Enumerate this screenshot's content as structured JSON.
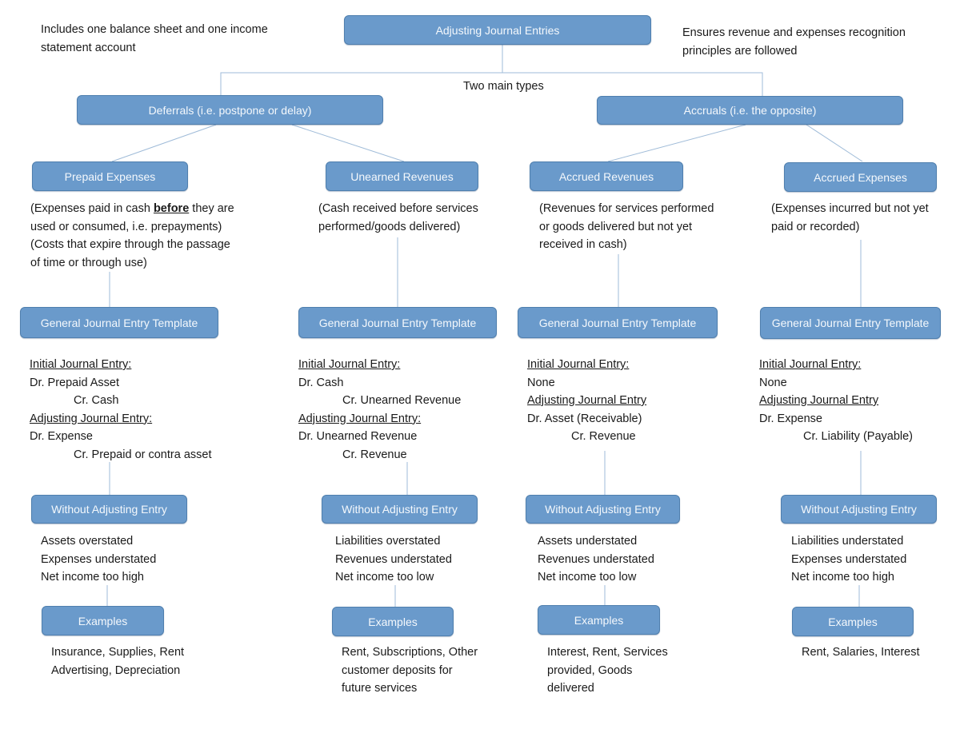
{
  "root": {
    "title": "Adjusting Journal Entries",
    "note_left": [
      "Includes one balance sheet and one income",
      "statement account"
    ],
    "note_right": [
      "Ensures revenue and expenses recognition",
      "principles are followed"
    ],
    "branch_label": "Two main types"
  },
  "types": [
    {
      "label": "Deferrals (i.e. postpone or delay)"
    },
    {
      "label": "Accruals (i.e. the opposite)"
    }
  ],
  "columns": [
    {
      "title": "Prepaid Expenses",
      "description": [
        {
          "pre": "(Expenses paid in cash ",
          "em": "before",
          "post": " they are"
        },
        {
          "pre": "used or consumed, i.e. prepayments)"
        },
        {
          "pre": "(Costs that expire through the passage"
        },
        {
          "pre": "of time or through use)"
        }
      ],
      "template_label": "General Journal Entry Template",
      "entries": [
        {
          "text": "Initial Journal Entry:",
          "style": "heading"
        },
        {
          "text": "Dr. Prepaid Asset",
          "style": "debit"
        },
        {
          "text": "Cr. Cash",
          "style": "credit"
        },
        {
          "text": "Adjusting Journal Entry:",
          "style": "heading"
        },
        {
          "text": "Dr. Expense",
          "style": "debit"
        },
        {
          "text": "Cr. Prepaid or contra asset",
          "style": "credit"
        }
      ],
      "without_label": "Without Adjusting Entry",
      "effects": [
        "Assets overstated",
        "Expenses understated",
        "Net income too high"
      ],
      "examples_label": "Examples",
      "examples": [
        "Insurance, Supplies, Rent",
        "Advertising, Depreciation"
      ]
    },
    {
      "title": "Unearned Revenues",
      "description": [
        {
          "pre": "(Cash received before services"
        },
        {
          "pre": "performed/goods delivered)"
        }
      ],
      "template_label": "General Journal Entry Template",
      "entries": [
        {
          "text": "Initial Journal Entry:",
          "style": "heading"
        },
        {
          "text": "Dr. Cash",
          "style": "debit"
        },
        {
          "text": "Cr. Unearned Revenue",
          "style": "credit"
        },
        {
          "text": "Adjusting Journal Entry:",
          "style": "heading"
        },
        {
          "text": "Dr. Unearned Revenue",
          "style": "debit"
        },
        {
          "text": "Cr. Revenue",
          "style": "credit"
        }
      ],
      "without_label": "Without Adjusting Entry",
      "effects": [
        "Liabilities overstated",
        "Revenues understated",
        "Net income too low"
      ],
      "examples_label": "Examples",
      "examples": [
        "Rent, Subscriptions, Other",
        "customer deposits for",
        "future services"
      ]
    },
    {
      "title": "Accrued Revenues",
      "description": [
        {
          "pre": "(Revenues for services performed"
        },
        {
          "pre": "or goods delivered but not yet"
        },
        {
          "pre": "received in cash)"
        }
      ],
      "template_label": "General Journal Entry Template",
      "entries": [
        {
          "text": "Initial Journal Entry:",
          "style": "heading"
        },
        {
          "text": "None",
          "style": "debit"
        },
        {
          "text": "Adjusting Journal Entry",
          "style": "heading"
        },
        {
          "text": "Dr. Asset (Receivable)",
          "style": "debit"
        },
        {
          "text": "Cr. Revenue",
          "style": "credit"
        }
      ],
      "without_label": "Without Adjusting Entry",
      "effects": [
        "Assets understated",
        "Revenues understated",
        "Net income too low"
      ],
      "examples_label": "Examples",
      "examples": [
        "Interest, Rent, Services",
        "provided, Goods",
        "delivered"
      ]
    },
    {
      "title": "Accrued Expenses",
      "description": [
        {
          "pre": "(Expenses incurred but not yet"
        },
        {
          "pre": "paid or recorded)"
        }
      ],
      "template_label": "General Journal Entry Template",
      "entries": [
        {
          "text": "Initial Journal Entry:",
          "style": "heading"
        },
        {
          "text": "None",
          "style": "debit"
        },
        {
          "text": "Adjusting Journal Entry",
          "style": "heading"
        },
        {
          "text": "Dr. Expense",
          "style": "debit"
        },
        {
          "text": "Cr. Liability (Payable)",
          "style": "credit"
        }
      ],
      "without_label": "Without Adjusting Entry",
      "effects": [
        "Liabilities understated",
        "Expenses understated",
        "Net income too high"
      ],
      "examples_label": "Examples",
      "examples": [
        "Rent, Salaries, Interest"
      ]
    }
  ]
}
